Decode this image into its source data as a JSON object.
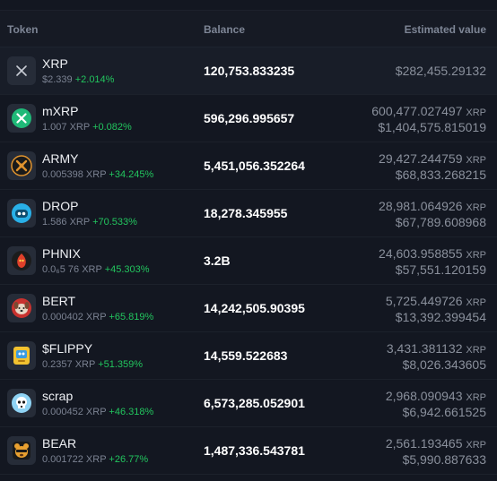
{
  "header": {
    "token": "Token",
    "balance": "Balance",
    "estimated_value": "Estimated value"
  },
  "tokens": [
    {
      "name": "XRP",
      "price": "$2.339",
      "change": "+2.014%",
      "balance": "120,753.833235",
      "value_xrp": "",
      "value_xrp_unit": "",
      "value_usd": "$282,455.29132",
      "icon": "xrp-x-icon",
      "icon_color": "#c8ccd4"
    },
    {
      "name": "mXRP",
      "price": "1.007 XRP",
      "change": "+0.082%",
      "balance": "596,296.995657",
      "value_xrp": "600,477.027497",
      "value_xrp_unit": "XRP",
      "value_usd": "$1,404,575.815019",
      "icon": "mxrp-coin-icon",
      "icon_color": "#1fb978"
    },
    {
      "name": "ARMY",
      "price": "0.005398 XRP",
      "change": "+34.245%",
      "balance": "5,451,056.352264",
      "value_xrp": "29,427.244759",
      "value_xrp_unit": "XRP",
      "value_usd": "$68,833.268215",
      "icon": "army-emblem-icon",
      "icon_color": "#e0932e"
    },
    {
      "name": "DROP",
      "price": "1.586 XRP",
      "change": "+70.533%",
      "balance": "18,278.345955",
      "value_xrp": "28,981.064926",
      "value_xrp_unit": "XRP",
      "value_usd": "$67,789.608968",
      "icon": "drop-mascot-icon",
      "icon_color": "#29b0e8"
    },
    {
      "name": "PHNIX",
      "price": "0.0₆5 76 XRP",
      "change": "+45.303%",
      "balance": "3.2B",
      "value_xrp": "24,603.958855",
      "value_xrp_unit": "XRP",
      "value_usd": "$57,551.120159",
      "icon": "phoenix-icon",
      "icon_color": "#e0402a"
    },
    {
      "name": "BERT",
      "price": "0.000402 XRP",
      "change": "+65.819%",
      "balance": "14,242,505.90395",
      "value_xrp": "5,725.449726",
      "value_xrp_unit": "XRP",
      "value_usd": "$13,392.399454",
      "icon": "bert-dog-icon",
      "icon_color": "#e8d6c4"
    },
    {
      "name": "$FLIPPY",
      "price": "0.2357 XRP",
      "change": "+51.359%",
      "balance": "14,559.522683",
      "value_xrp": "3,431.381132",
      "value_xrp_unit": "XRP",
      "value_usd": "$8,026.343605",
      "icon": "flippy-icon",
      "icon_color": "#f2c230"
    },
    {
      "name": "scrap",
      "price": "0.000452 XRP",
      "change": "+46.318%",
      "balance": "6,573,285.052901",
      "value_xrp": "2,968.090943",
      "value_xrp_unit": "XRP",
      "value_usd": "$6,942.661525",
      "icon": "scrap-skull-icon",
      "icon_color": "#8fd3f4"
    },
    {
      "name": "BEAR",
      "price": "0.001722 XRP",
      "change": "+26.77%",
      "balance": "1,487,336.543781",
      "value_xrp": "2,561.193465",
      "value_xrp_unit": "XRP",
      "value_usd": "$5,990.887633",
      "icon": "bear-icon",
      "icon_color": "#e8a030"
    }
  ]
}
